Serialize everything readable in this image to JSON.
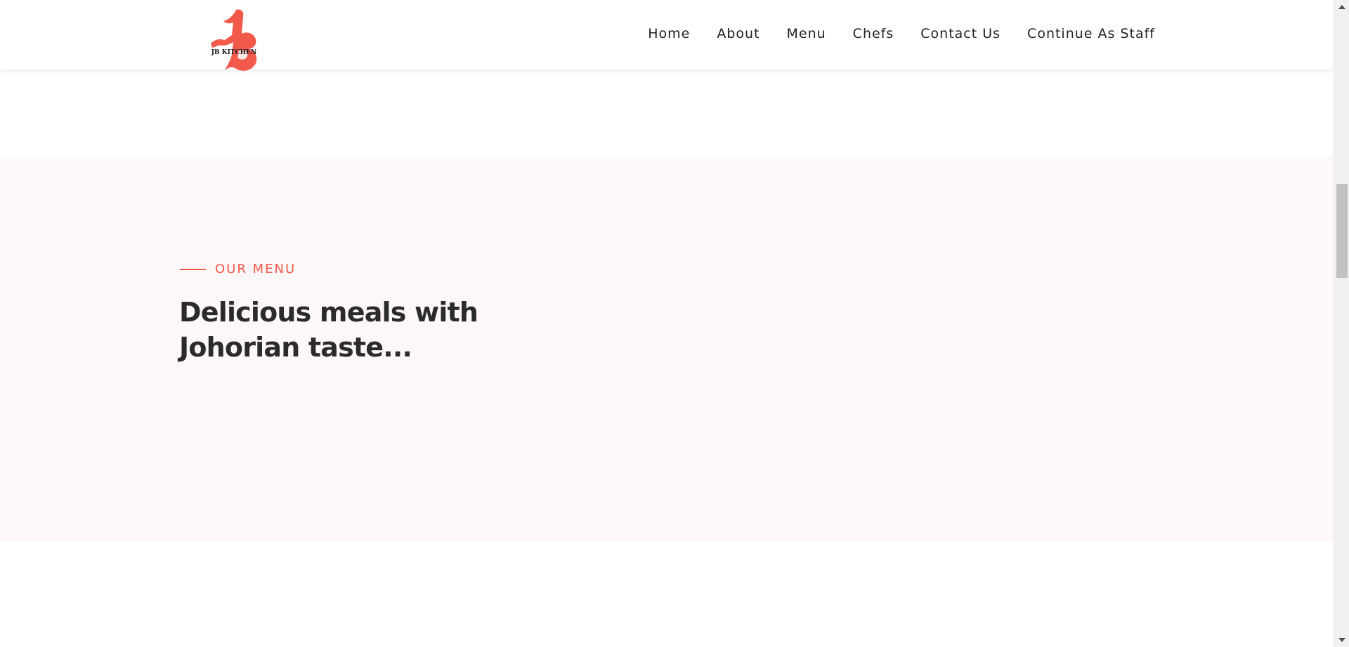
{
  "brand": {
    "logo_text": "JB KITCHEN",
    "logo_color": "#f2594b"
  },
  "nav": {
    "items": [
      {
        "label": "Home"
      },
      {
        "label": "About"
      },
      {
        "label": "Menu"
      },
      {
        "label": "Chefs"
      },
      {
        "label": "Contact Us"
      },
      {
        "label": "Continue As Staff"
      }
    ]
  },
  "menu_section": {
    "eyebrow": "OUR MENU",
    "headline_line1": "Delicious meals with",
    "headline_line2": "Johorian taste...",
    "background": "#fdf8f7"
  },
  "colors": {
    "accent": "#f2594b",
    "text_dark": "#2b2b2b"
  },
  "scrollbar": {
    "icons": [
      "scroll-up-arrow-icon",
      "scroll-down-arrow-icon"
    ]
  }
}
